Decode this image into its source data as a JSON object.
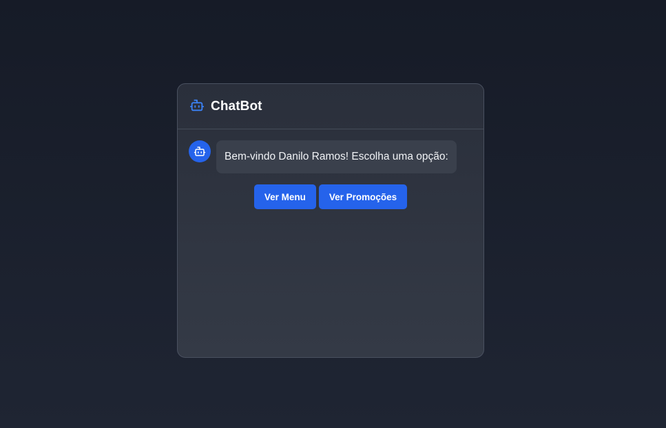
{
  "header": {
    "title": "ChatBot",
    "icon": "robot-icon"
  },
  "messages": [
    {
      "sender": "bot",
      "avatar_icon": "robot-icon",
      "text": "Bem-vindo Danilo Ramos! Escolha uma opção:"
    }
  ],
  "options": [
    {
      "label": "Ver Menu"
    },
    {
      "label": "Ver Promoções"
    }
  ],
  "colors": {
    "accent": "#2563eb",
    "background": "#1a1f2b",
    "panel": "#2f3440",
    "bubble": "#3a404c"
  }
}
